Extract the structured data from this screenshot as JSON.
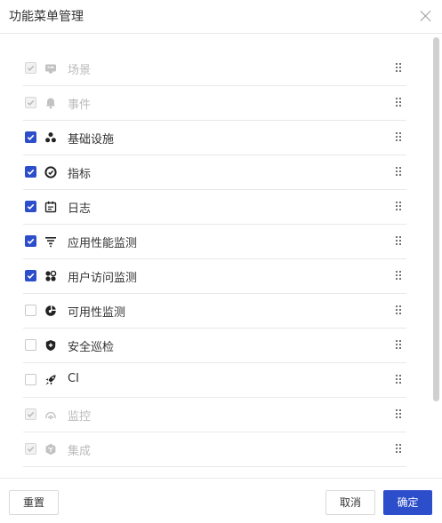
{
  "dialog": {
    "title": "功能菜单管理",
    "close_icon": "close-icon"
  },
  "menu_items": [
    {
      "label": "场景",
      "icon": "scene-icon",
      "checked": true,
      "disabled": true
    },
    {
      "label": "事件",
      "icon": "bell-icon",
      "checked": true,
      "disabled": true
    },
    {
      "label": "基础设施",
      "icon": "infrastructure-icon",
      "checked": true,
      "disabled": false
    },
    {
      "label": "指标",
      "icon": "metric-icon",
      "checked": true,
      "disabled": false
    },
    {
      "label": "日志",
      "icon": "log-icon",
      "checked": true,
      "disabled": false
    },
    {
      "label": "应用性能监测",
      "icon": "apm-icon",
      "checked": true,
      "disabled": false
    },
    {
      "label": "用户访问监测",
      "icon": "rum-icon",
      "checked": true,
      "disabled": false
    },
    {
      "label": "可用性监测",
      "icon": "dial-icon",
      "checked": false,
      "disabled": false
    },
    {
      "label": "安全巡检",
      "icon": "shield-icon",
      "checked": false,
      "disabled": false
    },
    {
      "label": "CI",
      "icon": "rocket-icon",
      "checked": false,
      "disabled": false
    },
    {
      "label": "监控",
      "icon": "monitor-icon",
      "checked": true,
      "disabled": true
    },
    {
      "label": "集成",
      "icon": "integration-icon",
      "checked": true,
      "disabled": true
    }
  ],
  "footer": {
    "reset_label": "重置",
    "cancel_label": "取消",
    "ok_label": "确定"
  },
  "colors": {
    "primary": "#2d4ecb",
    "disabled_text": "#bbbbbb",
    "border": "#e8e8e8"
  }
}
